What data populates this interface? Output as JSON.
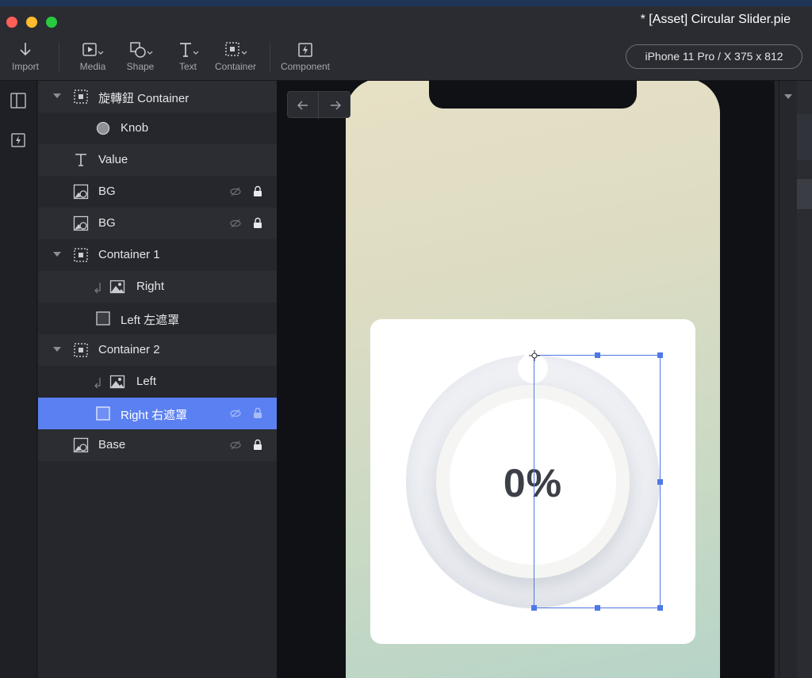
{
  "window": {
    "title": "* [Asset] Circular Slider.pie",
    "controls": {
      "close_color": "#ff5f57",
      "minimize_color": "#febc2e",
      "maximize_color": "#28c840"
    }
  },
  "toolbar": {
    "items": [
      {
        "label": "Import",
        "icon": "import-arrow-icon"
      },
      {
        "label": "Media",
        "icon": "media-icon"
      },
      {
        "label": "Shape",
        "icon": "shape-icon"
      },
      {
        "label": "Text",
        "icon": "text-icon"
      },
      {
        "label": "Container",
        "icon": "container-icon"
      },
      {
        "label": "Component",
        "icon": "component-icon"
      }
    ],
    "device": "iPhone 11 Pro / X  375 x 812"
  },
  "rail": {
    "icons": [
      "panels-icon",
      "component-icon"
    ]
  },
  "layers": [
    {
      "label": "旋轉鈕 Container",
      "icon": "container-icon",
      "expanded": true
    },
    {
      "label": "Knob",
      "icon": "circle-icon"
    },
    {
      "label": "Value",
      "icon": "text-icon"
    },
    {
      "label": "BG",
      "icon": "image-shape-icon",
      "hidden": true,
      "locked": true
    },
    {
      "label": "BG",
      "icon": "image-shape-icon",
      "hidden": true,
      "locked": true
    },
    {
      "label": "Container 1",
      "icon": "container-icon",
      "expanded": true
    },
    {
      "label": "Right",
      "icon": "image-icon",
      "masked": true
    },
    {
      "label": "Left 左遮罩",
      "icon": "rectangle-icon"
    },
    {
      "label": "Container 2",
      "icon": "container-icon",
      "expanded": true
    },
    {
      "label": "Left",
      "icon": "image-icon",
      "masked": true
    },
    {
      "label": "Right 右遮罩",
      "icon": "rectangle-icon",
      "selected": true,
      "hidden": true,
      "locked": true
    },
    {
      "label": "Base",
      "icon": "image-shape-icon",
      "hidden": true,
      "locked": true
    }
  ],
  "canvas": {
    "value": "0%",
    "colors": {
      "accent": "#5b80f2",
      "selection": "#4f78e8",
      "value_text": "#3c3f47"
    }
  }
}
